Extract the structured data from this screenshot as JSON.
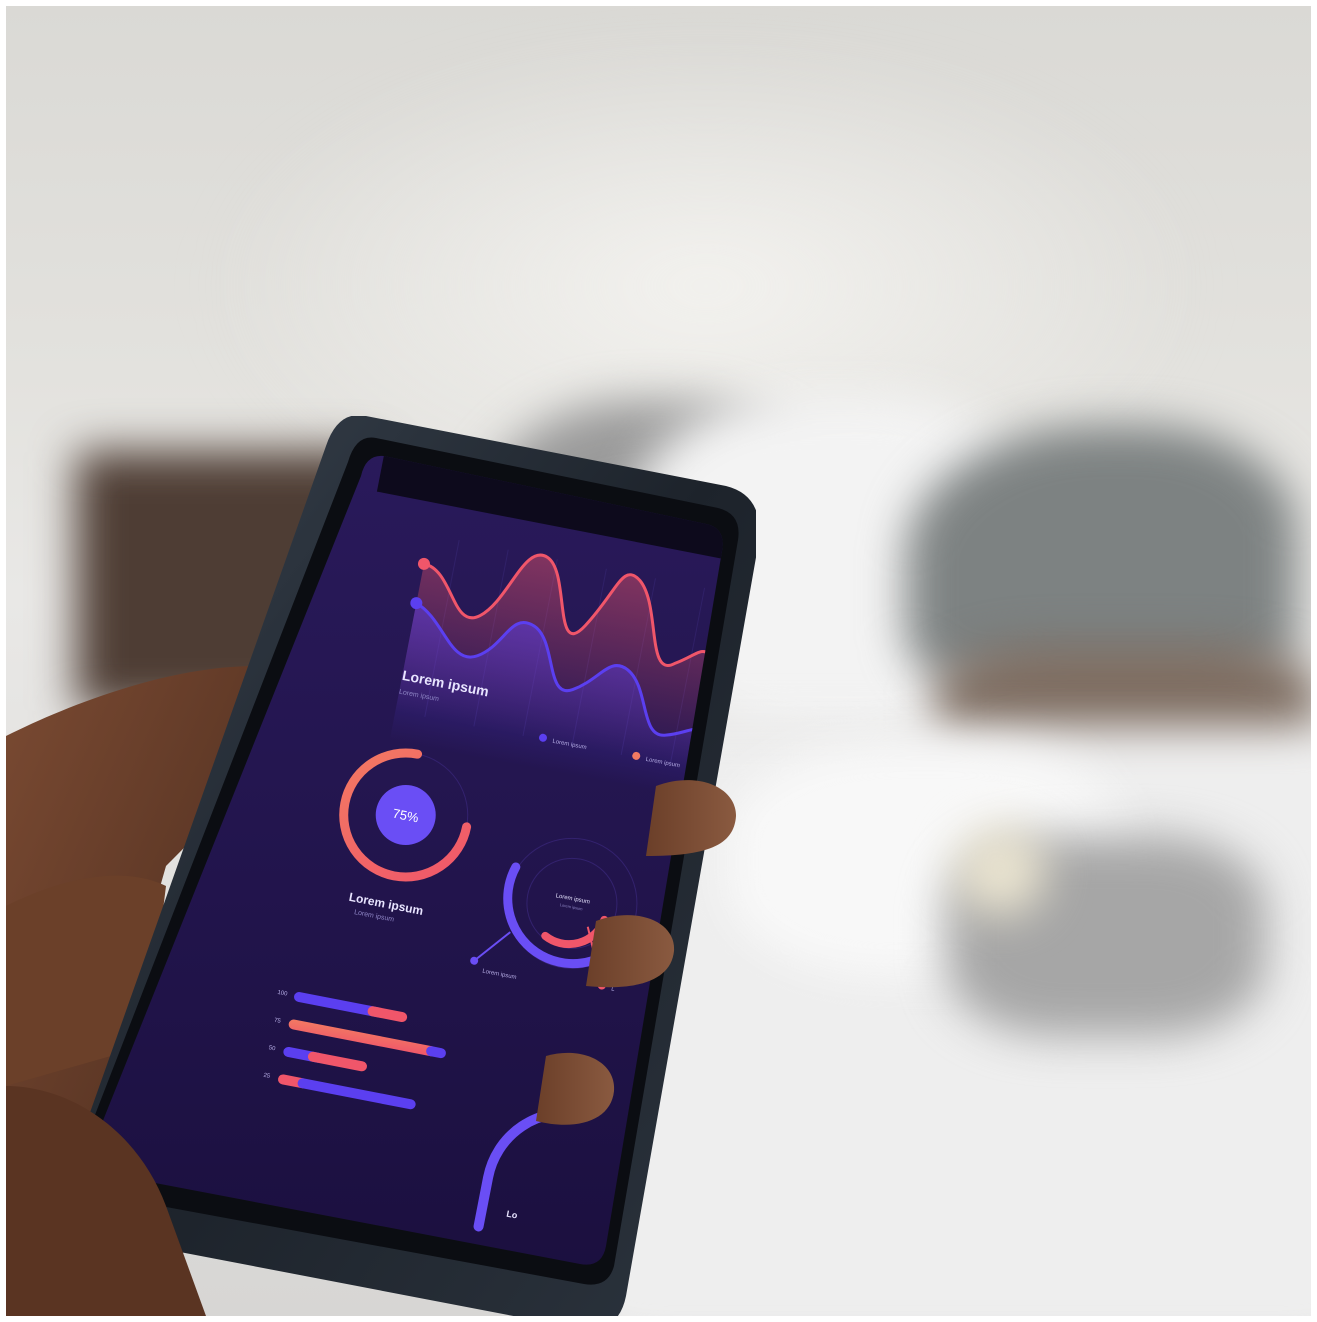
{
  "screen": {
    "colors": {
      "background": "#22124a",
      "red_accent": "#f0566a",
      "blue_accent": "#5b3ff0",
      "ring_fill": "#6a4ef5"
    },
    "wave_chart": {
      "title": "Lorem ipsum",
      "subtitle": "Lorem ipsum",
      "legend": [
        "Lorem ipsum",
        "Lorem ipsum"
      ]
    },
    "donut": {
      "percent_label": "75%",
      "percent_value": 75,
      "title": "Lorem ipsum",
      "subtitle": "Lorem ipsum"
    },
    "gauge": {
      "center_title": "Lorem ipsum",
      "center_subtitle": "Lorem ipsum",
      "callout_left": "Lorem ipsum",
      "callout_right": "L"
    },
    "bars": {
      "tick_labels": [
        "100",
        "75",
        "50",
        "25"
      ]
    },
    "partial_arc": {
      "label": "Lo"
    }
  }
}
